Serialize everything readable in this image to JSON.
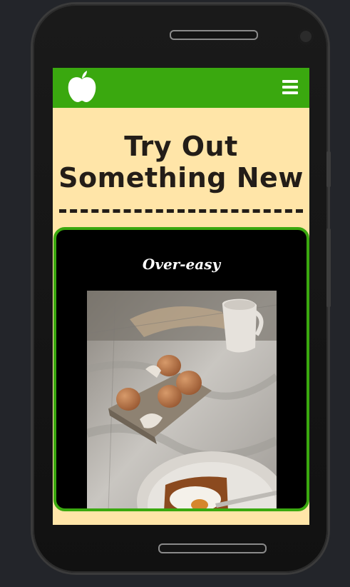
{
  "header": {
    "logo_icon": "apple-icon",
    "menu_icon": "hamburger-menu-icon",
    "brand_color": "#3aa80f"
  },
  "hero": {
    "title_line1": "Try Out",
    "title_line2": "Something New"
  },
  "card": {
    "title": "Over-easy",
    "image_icon": "eggs-breakfast-photo"
  },
  "colors": {
    "page_background": "#ffe5a8",
    "text": "#231d18",
    "card_background": "#000000"
  }
}
